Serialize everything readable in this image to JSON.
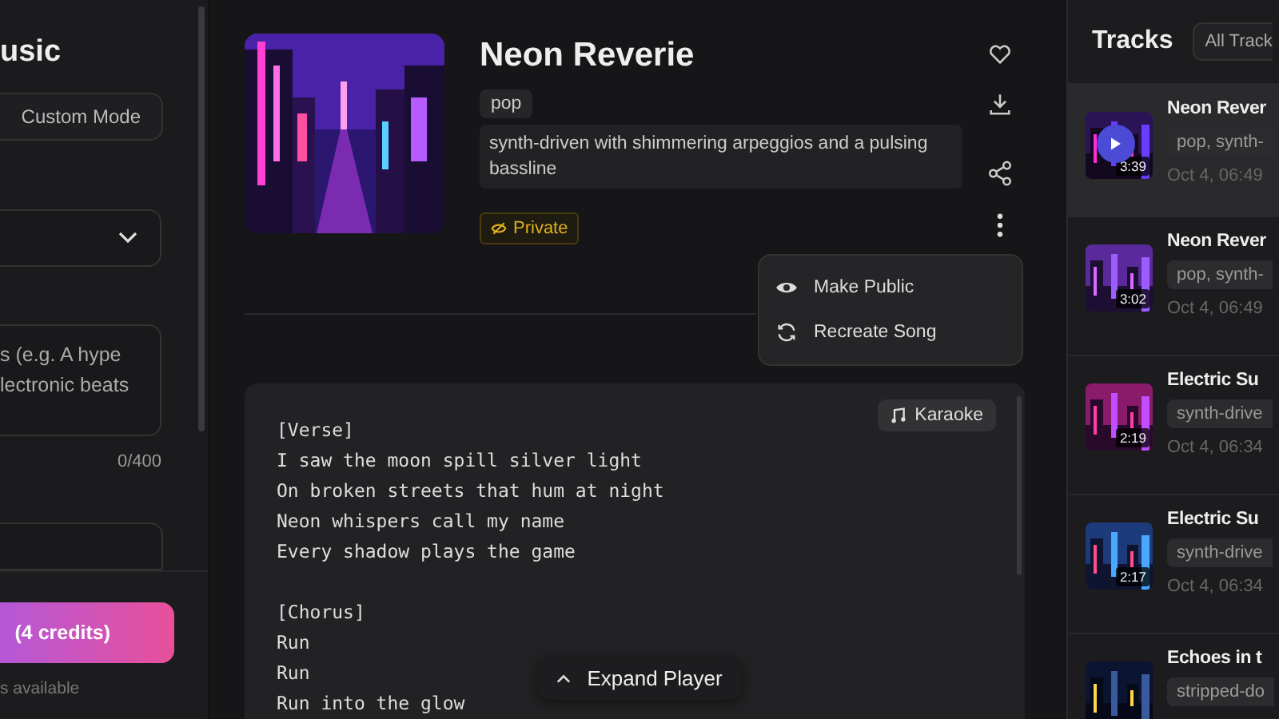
{
  "create_panel": {
    "title": "usic",
    "mode_button": "Custom Mode",
    "prompt_placeholder": "s (e.g. A hype\nlectronic beats",
    "char_count": "0/400",
    "create_button": "(4 credits)",
    "credits_note": "s available"
  },
  "song": {
    "title": "Neon Reverie",
    "genre_tag": "pop",
    "description": "synth-driven with shimmering arpeggios and a pulsing bassline",
    "visibility": "Private"
  },
  "menu": {
    "items": [
      {
        "label": "Make Public"
      },
      {
        "label": "Recreate Song"
      }
    ]
  },
  "lyrics": {
    "karaoke_button": "Karaoke",
    "stanzas": [
      [
        "[Verse]",
        "I saw the moon spill silver light",
        "On broken streets that hum at night",
        "Neon whispers call my name",
        "Every shadow plays the game"
      ],
      [
        "[Chorus]",
        "Run",
        "Run",
        "Run into the glow"
      ]
    ]
  },
  "expand_player": "Expand Player",
  "tracks": {
    "title": "Tracks",
    "filter": "All Track",
    "items": [
      {
        "title": "Neon Rever",
        "tags": "pop, synth-",
        "date": "Oct 4, 06:49",
        "duration": "3:39",
        "selected": true
      },
      {
        "title": "Neon Rever",
        "tags": "pop, synth-",
        "date": "Oct 4, 06:49",
        "duration": "3:02",
        "selected": false
      },
      {
        "title": "Electric Su",
        "tags": "synth-drive",
        "date": "Oct 4, 06:34",
        "duration": "2:19",
        "selected": false
      },
      {
        "title": "Electric Su",
        "tags": "synth-drive",
        "date": "Oct 4, 06:34",
        "duration": "2:17",
        "selected": false
      },
      {
        "title": "Echoes in t",
        "tags": "stripped-do",
        "selected": false
      }
    ]
  }
}
